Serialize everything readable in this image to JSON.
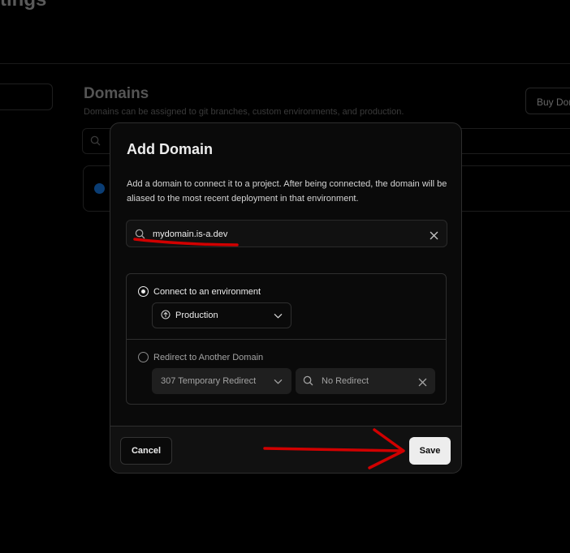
{
  "background": {
    "page_title": "tings",
    "section_title": "Domains",
    "section_description": "Domains can be assigned to git branches, custom environments, and production.",
    "buy_button_label": "Buy Domain"
  },
  "modal": {
    "title": "Add Domain",
    "description": "Add a domain to connect it to a project. After being connected, the domain will be aliased to the most recent deployment in that environment.",
    "domain_input": {
      "value": "mydomain.is-a.dev"
    },
    "options": {
      "connect": {
        "label": "Connect to an environment",
        "selected": true,
        "environment": "Production"
      },
      "redirect": {
        "label": "Redirect to Another Domain",
        "selected": false,
        "redirect_type": "307 Temporary Redirect",
        "target_placeholder": "No Redirect"
      }
    },
    "footer": {
      "cancel_label": "Cancel",
      "save_label": "Save"
    }
  },
  "colors": {
    "annotation": "#d10000",
    "save_bg": "#ededed",
    "modal_bg": "#0a0a0a"
  }
}
